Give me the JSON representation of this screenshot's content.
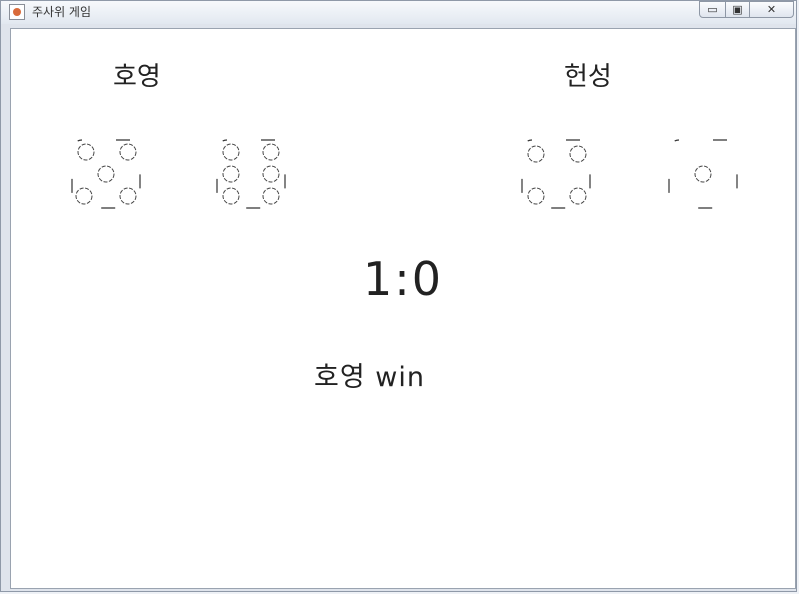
{
  "window": {
    "title": "주사위 게임",
    "controls": {
      "minimize": "▭",
      "maximize": "▣",
      "close": "✕"
    }
  },
  "players": [
    {
      "name": "호영",
      "dice": [
        5,
        6
      ]
    },
    {
      "name": "헌성",
      "dice": [
        4,
        1
      ]
    }
  ],
  "score": "1:0",
  "result": "호영 win"
}
